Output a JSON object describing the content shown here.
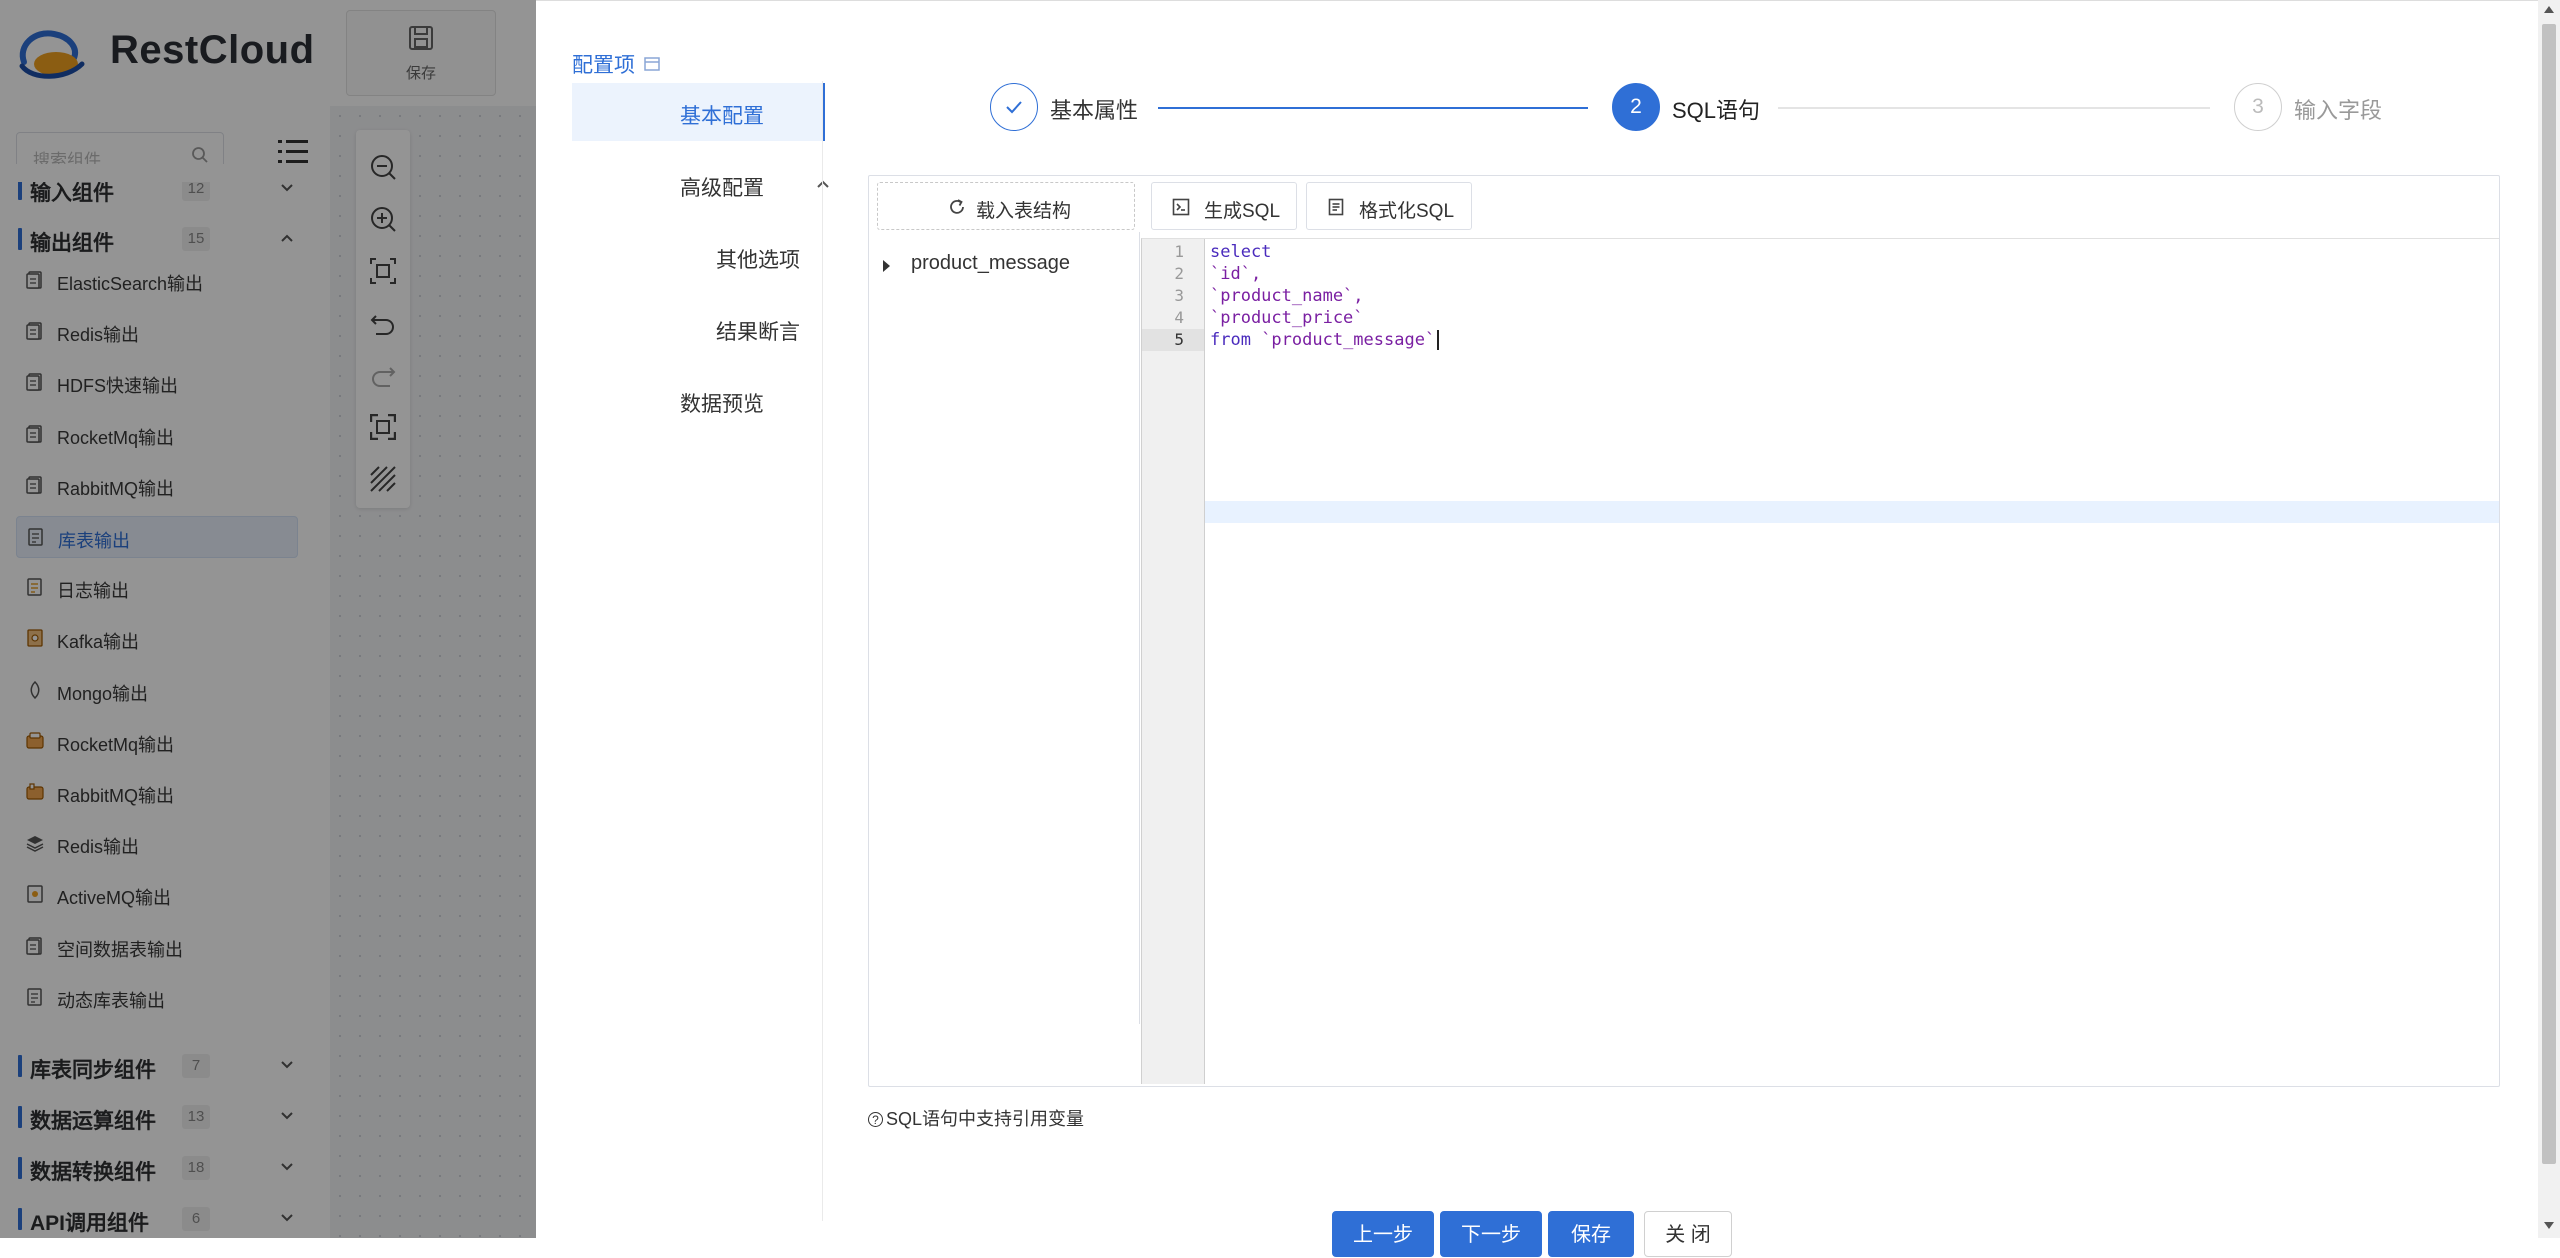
{
  "app": {
    "brand": "RestCloud",
    "toolbar": {
      "save_label": "保存"
    },
    "search": {
      "placeholder": "搜索组件"
    },
    "groups": [
      {
        "name": "输入组件",
        "count": "12",
        "expanded": false
      },
      {
        "name": "输出组件",
        "count": "15",
        "expanded": true
      },
      {
        "name": "库表同步组件",
        "count": "7",
        "expanded": false
      },
      {
        "name": "数据运算组件",
        "count": "13",
        "expanded": false
      },
      {
        "name": "数据转换组件",
        "count": "18",
        "expanded": false
      },
      {
        "name": "API调用组件",
        "count": "6",
        "expanded": false
      }
    ],
    "output_items": [
      {
        "name": "ElasticSearch输出",
        "icon": "document-icon"
      },
      {
        "name": "Redis输出",
        "icon": "document-icon"
      },
      {
        "name": "HDFS快速输出",
        "icon": "document-icon"
      },
      {
        "name": "RocketMq输出",
        "icon": "document-icon"
      },
      {
        "name": "RabbitMQ输出",
        "icon": "document-icon"
      },
      {
        "name": "库表输出",
        "icon": "table-doc-icon",
        "active": true
      },
      {
        "name": "日志输出",
        "icon": "log-icon"
      },
      {
        "name": "Kafka输出",
        "icon": "kafka-icon"
      },
      {
        "name": "Mongo输出",
        "icon": "mongo-icon"
      },
      {
        "name": "RocketMq输出",
        "icon": "rocket-icon"
      },
      {
        "name": "RabbitMQ输出",
        "icon": "rabbit-icon"
      },
      {
        "name": "Redis输出",
        "icon": "layers-icon"
      },
      {
        "name": "ActiveMQ输出",
        "icon": "mq-icon"
      },
      {
        "name": "空间数据表输出",
        "icon": "document-icon"
      },
      {
        "name": "动态库表输出",
        "icon": "table-doc-icon"
      }
    ]
  },
  "drawer": {
    "config_title": "配置项",
    "nav": [
      {
        "label": "基本配置",
        "active": true
      },
      {
        "label": "高级配置",
        "expanded": true
      },
      {
        "label": "其他选项"
      },
      {
        "label": "结果断言"
      },
      {
        "label": "数据预览"
      }
    ],
    "steps": [
      {
        "label": "基本属性",
        "number": "1",
        "status": "done"
      },
      {
        "label": "SQL语句",
        "number": "2",
        "status": "active"
      },
      {
        "label": "输入字段",
        "number": "3",
        "status": "pending"
      }
    ],
    "buttons": {
      "load_table": "载入表结构",
      "generate_sql": "生成SQL",
      "format_sql": "格式化SQL"
    },
    "tree": {
      "table": "product_message"
    },
    "editor": {
      "lines": [
        {
          "no": "1",
          "text": "select"
        },
        {
          "no": "2",
          "text": "`id`,"
        },
        {
          "no": "3",
          "text": "`product_name`,"
        },
        {
          "no": "4",
          "text": "`product_price`"
        },
        {
          "no": "5",
          "text": "from `product_message`"
        }
      ],
      "active_line": "5"
    },
    "note": "SQL语句中支持引用变量",
    "footer": {
      "prev": "上一步",
      "next": "下一步",
      "save": "保存",
      "close": "关 闭"
    }
  },
  "colors": {
    "primary": "#2f6fd6",
    "overlay": "rgba(0,0,0,0.42)",
    "keyword": "#4a2bbd",
    "identifier": "#7a1fa2"
  }
}
